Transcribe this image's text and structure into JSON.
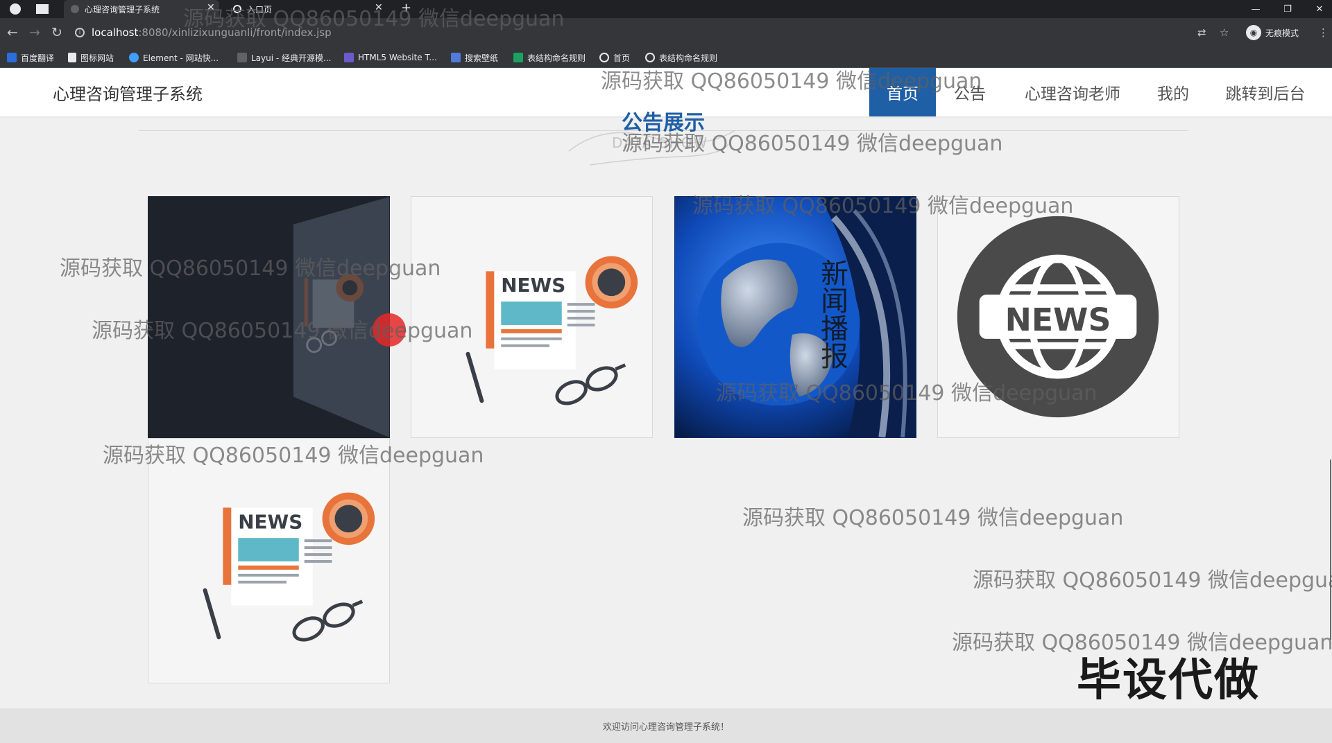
{
  "browser": {
    "tabs": [
      {
        "title": "心理咨询管理子系统"
      },
      {
        "title": "入口页"
      }
    ],
    "url_host": "localhost",
    "url_path": ":8080/xinlizixunguanli/front/index.jsp",
    "profile_label": "无痕模式",
    "bookmarks": [
      {
        "label": "百度翻译"
      },
      {
        "label": "图标网站"
      },
      {
        "label": "Element - 网站快..."
      },
      {
        "label": "Layui - 经典开源模..."
      },
      {
        "label": "HTML5 Website T..."
      },
      {
        "label": "搜索壁纸"
      },
      {
        "label": "表结构命名规则"
      },
      {
        "label": "首页"
      },
      {
        "label": "表结构命名规则"
      }
    ]
  },
  "header": {
    "brand": "心理咨询管理子系统",
    "menu": [
      {
        "label": "首页",
        "active": true
      },
      {
        "label": "公告",
        "active": false
      },
      {
        "label": "心理咨询老师",
        "active": false
      },
      {
        "label": "我的",
        "active": false
      },
      {
        "label": "跳转到后台",
        "active": false
      }
    ]
  },
  "section": {
    "title": "公告展示",
    "subtitle": "DATA SHOW"
  },
  "cards": [
    {
      "image": "news-icon-dimmed"
    },
    {
      "image": "news-icon",
      "label": "NEWS"
    },
    {
      "image": "globe-broadcast",
      "label": "新闻播报"
    },
    {
      "image": "news-globe-badge",
      "label": "NEWS"
    },
    {
      "image": "news-icon",
      "label": "NEWS"
    }
  ],
  "footer": {
    "text": "欢迎访问心理咨询管理子系统！"
  },
  "overlay": {
    "watermark": "源码获取 QQ86050149 微信deepguan",
    "watermark_cut": "源码获取 QQ86050149 微信deepgua",
    "promo": "毕设代做"
  },
  "colors": {
    "accent": "#1f5fa6",
    "news_orange": "#e8743b",
    "news_teal": "#5fb8c8"
  }
}
